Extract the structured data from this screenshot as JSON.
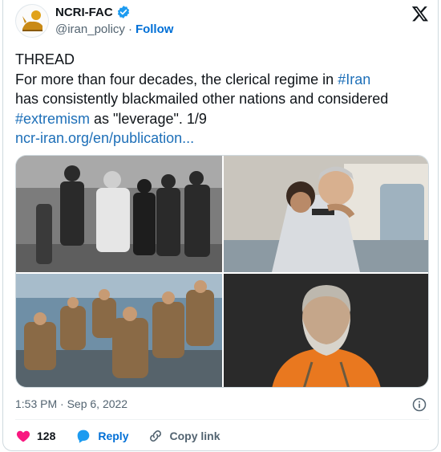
{
  "header": {
    "display_name": "NCRI-FAC",
    "handle": "@iran_policy",
    "separator": "·",
    "follow_label": "Follow"
  },
  "tweet": {
    "line_thread": "THREAD",
    "line_1_pre": "For more than four decades, the clerical regime in ",
    "hashtag_iran": "#Iran",
    "line_2": "has consistently blackmailed other nations and considered",
    "hashtag_extremism": "#extremism",
    "line_3_post": " as \"leverage\". 1/9",
    "link": "ncr-iran.org/en/publication..."
  },
  "media": {
    "images": [
      "hostages-photo",
      "hijacking-photo",
      "sailors-photo",
      "captive-photo"
    ]
  },
  "meta": {
    "timestamp": "1:53 PM · Sep 6, 2022"
  },
  "actions": {
    "like_count": "128",
    "reply_label": "Reply",
    "copy_link_label": "Copy link"
  },
  "colors": {
    "accent": "#1d9bf0",
    "link": "#1d6fb8",
    "like": "#f91880",
    "muted": "#536471"
  }
}
